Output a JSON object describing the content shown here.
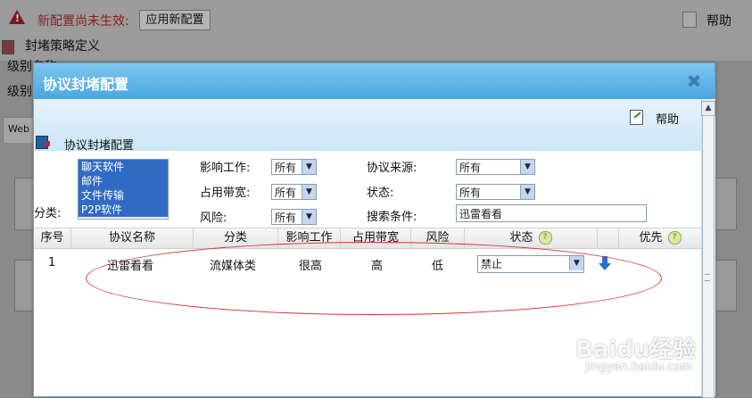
{
  "background": {
    "warning_text": "新配置尚未生效:",
    "apply_button": "应用新配置",
    "help_label": "帮助",
    "policy_title": "封堵策略定义",
    "level_label_1": "级别名称",
    "level_label_2": "级别",
    "tab_web": "Web"
  },
  "dialog": {
    "title": "协议封堵配置",
    "close_symbol": "✖",
    "help_label": "帮助",
    "section_title": "协议封堵配置",
    "filters": {
      "category_label": "分类:",
      "categories": [
        "聊天软件",
        "邮件",
        "文件传输",
        "P2P软件"
      ],
      "impact_label": "影响工作:",
      "impact_value": "所有",
      "bandwidth_label": "占用带宽:",
      "bandwidth_value": "所有",
      "risk_label": "风险:",
      "risk_value": "所有",
      "source_label": "协议来源:",
      "source_value": "所有",
      "status_label": "状态:",
      "status_value": "所有",
      "search_label": "搜索条件:",
      "search_value": "迅雷看看"
    },
    "table": {
      "headers": [
        "序号",
        "协议名称",
        "分类",
        "影响工作",
        "占用带宽",
        "风险",
        "状态",
        "优先"
      ],
      "rows": [
        {
          "index": "1",
          "name": "迅雷看看",
          "category": "流媒体类",
          "impact": "很高",
          "bandwidth": "高",
          "risk": "低",
          "status": "禁止"
        }
      ]
    }
  },
  "watermark": {
    "logo": "Baidu经验",
    "url": "jingyan.baidu.com"
  }
}
